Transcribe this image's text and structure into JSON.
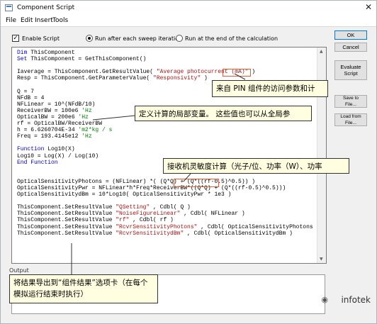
{
  "window": {
    "title": "Component Script",
    "close_glyph": "✕",
    "icon": "component-script-app-icon"
  },
  "menu": [
    "File",
    "Edit",
    "Insert",
    "Tools"
  ],
  "options": {
    "enable_script_label": "Enable Script",
    "enable_script_checked": true,
    "run_after_label": "Run after each sweep iteration",
    "run_end_label": "Run at the end of the calculation",
    "selected_run_mode": "after"
  },
  "buttons": {
    "ok": "OK",
    "cancel": "Cancel",
    "evaluate": "Evaluate Script",
    "save": "Save to File...",
    "load": "Load from File..."
  },
  "code_lines": [
    [
      {
        "t": "Dim",
        "c": "kw"
      },
      {
        "t": " ThisComponent",
        "c": "tx"
      }
    ],
    [
      {
        "t": "Set",
        "c": "kw"
      },
      {
        "t": " ThisComponent = GetThisComponent()",
        "c": "tx"
      }
    ],
    [
      {
        "t": "",
        "c": "tx"
      }
    ],
    [
      {
        "t": "Iaverage = ThisComponent.GetResultValue( ",
        "c": "tx"
      },
      {
        "t": "\"Average photocurrent (mA)\"",
        "c": "str"
      },
      {
        "t": " )",
        "c": "tx"
      }
    ],
    [
      {
        "t": "Resp = ThisComponent.GetParameterValue( ",
        "c": "tx"
      },
      {
        "t": "\"Responsivity\"",
        "c": "str"
      },
      {
        "t": " )",
        "c": "tx"
      }
    ],
    [
      {
        "t": "",
        "c": "tx"
      }
    ],
    [
      {
        "t": "Q = 7",
        "c": "tx"
      }
    ],
    [
      {
        "t": "NFdB = 4",
        "c": "tx"
      }
    ],
    [
      {
        "t": "NFLinear = 10^(NFdB/10)",
        "c": "tx"
      }
    ],
    [
      {
        "t": "ReceiverBW = 100e6 ",
        "c": "tx"
      },
      {
        "t": "'Hz",
        "c": "cm"
      }
    ],
    [
      {
        "t": "OpticalBW = 200e6 ",
        "c": "tx"
      },
      {
        "t": "'Hz",
        "c": "cm"
      }
    ],
    [
      {
        "t": "rf = OpticalBW/ReceiverBW",
        "c": "tx"
      }
    ],
    [
      {
        "t": "h = 6.6260704E-34 ",
        "c": "tx"
      },
      {
        "t": "'m2*kg / s",
        "c": "cm"
      }
    ],
    [
      {
        "t": "Freq = 193.4145e12 ",
        "c": "tx"
      },
      {
        "t": "'Hz",
        "c": "cm"
      }
    ],
    [
      {
        "t": "",
        "c": "tx"
      }
    ],
    [
      {
        "t": "Function",
        "c": "kw"
      },
      {
        "t": " Log10(X)",
        "c": "tx"
      }
    ],
    [
      {
        "t": "Log10 = Log(X) / Log(10)",
        "c": "tx"
      }
    ],
    [
      {
        "t": "End Function",
        "c": "kw"
      }
    ],
    [
      {
        "t": "",
        "c": "tx"
      }
    ],
    [
      {
        "t": "",
        "c": "tx"
      }
    ],
    [
      {
        "t": "OpticalSensitivityPhotons = (NFLinear) *( (Q*Q) + (Q*((rf-0.5)^0.5)) )",
        "c": "tx"
      }
    ],
    [
      {
        "t": "OpticalSensitivityPwr = NFLinear*h*Freq*ReceiverBW*((Q*Q) + (Q*((rf-0.5)^0.5)))",
        "c": "tx"
      }
    ],
    [
      {
        "t": "OpticalSensitivitydBm = 10*Log10( OpticalSensitivityPwr * 1e3 )",
        "c": "tx"
      }
    ],
    [
      {
        "t": "",
        "c": "tx"
      }
    ],
    [
      {
        "t": "ThisComponent.SetResultValue ",
        "c": "tx"
      },
      {
        "t": "\"QSetting\"",
        "c": "str"
      },
      {
        "t": " , Cdbl( Q )",
        "c": "tx"
      }
    ],
    [
      {
        "t": "ThisComponent.SetResultValue ",
        "c": "tx"
      },
      {
        "t": "\"NoiseFigureLinear\"",
        "c": "str"
      },
      {
        "t": " , Cdbl( NFLinear )",
        "c": "tx"
      }
    ],
    [
      {
        "t": "ThisComponent.SetResultValue ",
        "c": "tx"
      },
      {
        "t": "\"rf\"",
        "c": "str"
      },
      {
        "t": " , Cdbl( rf )",
        "c": "tx"
      }
    ],
    [
      {
        "t": "ThisComponent.SetResultValue ",
        "c": "tx"
      },
      {
        "t": "\"RcvrSensitivityPhotons\"",
        "c": "str"
      },
      {
        "t": " , Cdbl( OpticalSensitivityPhotons )",
        "c": "tx"
      }
    ],
    [
      {
        "t": "ThisComponent.SetResultValue ",
        "c": "tx"
      },
      {
        "t": "\"RcvrSensitivitydBm\"",
        "c": "str"
      },
      {
        "t": " , Cdbl( OpticalSensitivitydBm )",
        "c": "tx"
      }
    ]
  ],
  "output_label": "Output",
  "callouts": {
    "pin_access": "来自 PIN 组件的访问参数和计",
    "local_vars": "定义计算的局部变量。 这些值也可以从全局参",
    "sensitivity": "接收机灵敏度计算（光子/位、功率（W）、功率",
    "export_results": "将结果导出到“组件结果”选项卡（在每个模拟运行结束时执行）"
  },
  "watermark": "infotek",
  "colors": {
    "keyword": "#0000cc",
    "string": "#a31515",
    "comment": "#008000",
    "text": "#000000",
    "callout_bg": "#fffee0",
    "highlight": "#e06030"
  }
}
